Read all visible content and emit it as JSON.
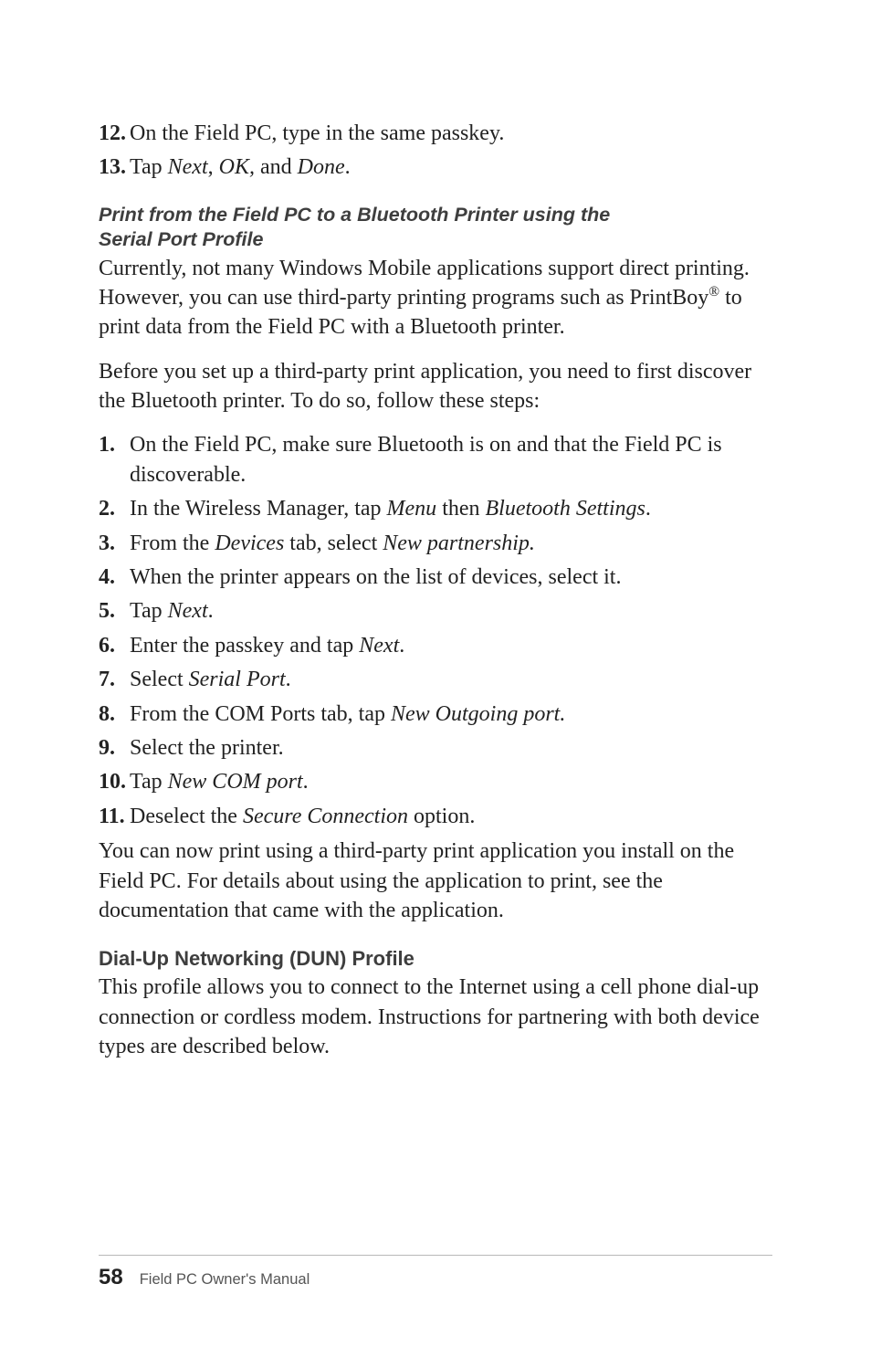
{
  "list_top": [
    {
      "num": "12.",
      "text_plain": "On the Field PC, type in the same passkey."
    },
    {
      "num": "13.",
      "pre": "Tap ",
      "i1": "Next",
      "mid1": ", ",
      "i2": "OK,",
      "mid2": " and ",
      "i3": "Done",
      "post": "."
    }
  ],
  "subhead1_l1": "Print from the Field PC to a Bluetooth Printer using the",
  "subhead1_l2": "Serial Port Profile",
  "para1_pre": "Currently, not many Windows Mobile applications support direct printing. However, you can use third-party printing programs such as PrintBoy",
  "para1_sup": "®",
  "para1_post": " to print data from the Field PC with a Bluetooth printer.",
  "para2": "Before you set up a third-party print application, you need to first discover the Bluetooth printer. To do so, follow these steps:",
  "list_main": [
    {
      "num": "1.",
      "pre": "On the Field PC, make sure Bluetooth is on and that the Field PC is discoverable."
    },
    {
      "num": "2.",
      "pre": "In the Wireless Manager, tap ",
      "i1": "Menu",
      "mid1": " then ",
      "i2": "Bluetooth Settings",
      "post1": "."
    },
    {
      "num": "3.",
      "pre": "From the ",
      "i1": "Devices",
      "mid1": " tab, select ",
      "i2": "New partnership.",
      "post1": ""
    },
    {
      "num": "4.",
      "pre": "When the printer appears on the list of devices, select it."
    },
    {
      "num": "5.",
      "pre": "Tap ",
      "i1": "Next",
      "post1": "."
    },
    {
      "num": "6.",
      "pre": "Enter the passkey and tap ",
      "i1": "Next",
      "post1": "."
    },
    {
      "num": "7.",
      "pre": "Select ",
      "i1": "Serial Port",
      "post1": "."
    },
    {
      "num": "8.",
      "pre": "From the COM Ports tab, tap ",
      "i1": "New Outgoing port.",
      "post1": ""
    },
    {
      "num": "9.",
      "pre": "Select the printer."
    },
    {
      "num": "10.",
      "pre": "Tap ",
      "i1": "New COM port",
      "post1": "."
    },
    {
      "num": "11.",
      "pre": "Deselect the ",
      "i1": "Secure Connection",
      "post1": " option."
    }
  ],
  "para3": "You can now print using a third-party print application you install on the Field PC. For details about using the application to print, see the documentation that came with the application.",
  "subhead2": "Dial-Up Networking (DUN) Profile",
  "para4": "This profile allows you to connect to the Internet using a cell phone dial-up connection or cordless modem. Instructions for partnering with both device types are described below.",
  "footer": {
    "page": "58",
    "title": "Field PC Owner's Manual"
  }
}
